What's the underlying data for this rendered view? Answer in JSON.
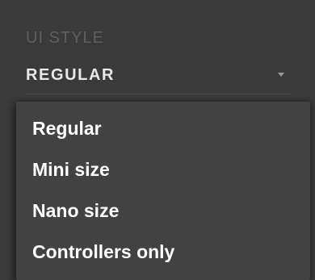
{
  "ui_style": {
    "label": "UI STYLE",
    "selected_value": "REGULAR",
    "options": [
      "Regular",
      "Mini size",
      "Nano size",
      "Controllers only"
    ]
  }
}
